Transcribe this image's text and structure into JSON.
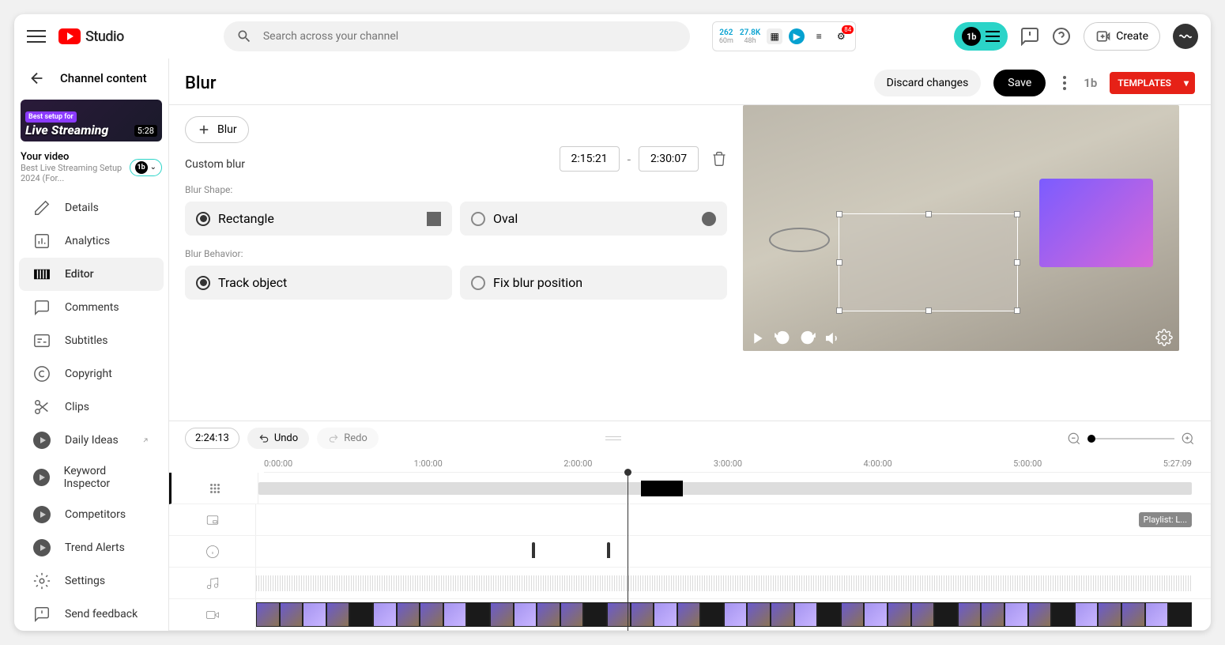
{
  "header": {
    "logo_text": "Studio",
    "search_placeholder": "Search across your channel",
    "ext": {
      "stat1": "262",
      "stat1_sub": "60m",
      "stat2": "27.8K",
      "stat2_sub": "48h",
      "notif": "84"
    },
    "tb_label": "1b",
    "create_label": "Create"
  },
  "sidebar": {
    "back_label": "Channel content",
    "thumb": {
      "tag": "Best setup for",
      "title": "Live Streaming",
      "duration": "5:28"
    },
    "video_meta": {
      "title": "Your video",
      "subtitle": "Best Live Streaming Setup 2024 (For..."
    },
    "nav": [
      {
        "label": "Details"
      },
      {
        "label": "Analytics"
      },
      {
        "label": "Editor"
      },
      {
        "label": "Comments"
      },
      {
        "label": "Subtitles"
      },
      {
        "label": "Copyright"
      },
      {
        "label": "Clips"
      },
      {
        "label": "Daily Ideas"
      },
      {
        "label": "Keyword Inspector"
      },
      {
        "label": "Competitors"
      },
      {
        "label": "Trend Alerts"
      },
      {
        "label": "Settings"
      },
      {
        "label": "Send feedback"
      }
    ]
  },
  "title_row": {
    "title": "Blur",
    "discard": "Discard changes",
    "save": "Save",
    "templates": "TEMPLATES"
  },
  "panel": {
    "add_blur": "Blur",
    "custom_label": "Custom blur",
    "time_start": "2:15:21",
    "time_end": "2:30:07",
    "shape_label": "Blur Shape:",
    "shape_rect": "Rectangle",
    "shape_oval": "Oval",
    "behavior_label": "Blur Behavior:",
    "behavior_track": "Track object",
    "behavior_fix": "Fix blur position"
  },
  "timeline": {
    "timecode": "2:24:13",
    "undo": "Undo",
    "redo": "Redo",
    "ticks": [
      "0:00:00",
      "1:00:00",
      "2:00:00",
      "3:00:00",
      "4:00:00",
      "5:00:00",
      "5:27:09"
    ],
    "end_card": "Playlist: L..."
  }
}
